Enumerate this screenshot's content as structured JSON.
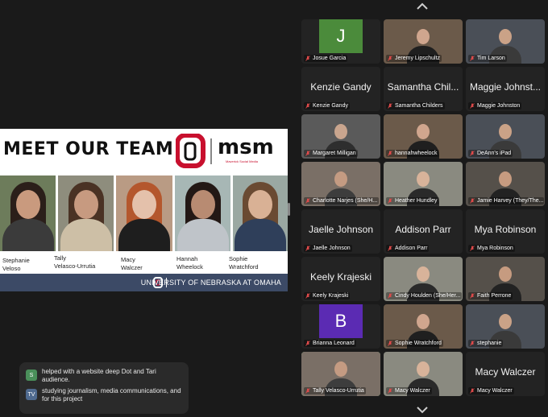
{
  "shared_slide": {
    "title": "MEET OUR TEAM",
    "logo_text": "msm",
    "logo_subtext": "Maverick Social Media",
    "team": [
      {
        "first": "Stephanie",
        "last": "Veloso"
      },
      {
        "first": "Tally",
        "last": "Velasco-Urrutia"
      },
      {
        "first": "Macy",
        "last": "Walczer"
      },
      {
        "first": "Hannah",
        "last": "Wheelock"
      },
      {
        "first": "Sophie",
        "last": "Wratchford"
      }
    ],
    "footer": "UNIVERSITY OF NEBRASKA AT OMAHA",
    "colors": {
      "brand_red": "#c8102e",
      "footer_bg": "#3c4a66"
    }
  },
  "chat": {
    "messages": [
      {
        "avatar": "S",
        "avatar_color": "#4a8f5a",
        "text": "helped with a website deep Dot and Tari audience."
      },
      {
        "avatar": "TV",
        "avatar_color": "#4f6a8f",
        "text": "studying journalism, media communications, and for this project"
      }
    ]
  },
  "gallery": {
    "scroll_up_icon": "chevron-up-icon",
    "scroll_down_icon": "chevron-down-icon",
    "participants": [
      {
        "name": "Josue Garcia",
        "mode": "initial",
        "initial": "J",
        "color": "#4b8b3b"
      },
      {
        "name": "Jeremy Lipschultz",
        "mode": "video"
      },
      {
        "name": "Tim Larson",
        "mode": "video"
      },
      {
        "name": "Kenzie Gandy",
        "mode": "name",
        "display": "Kenzie Gandy"
      },
      {
        "name": "Samantha Childers",
        "mode": "name",
        "display": "Samantha Chil..."
      },
      {
        "name": "Maggie Johnston",
        "mode": "name",
        "display": "Maggie Johnst..."
      },
      {
        "name": "Margaret Milligan",
        "mode": "video"
      },
      {
        "name": "hannahwheelock",
        "mode": "video"
      },
      {
        "name": "DeAnn's iPad",
        "mode": "video"
      },
      {
        "name": "Charlotte Narjes (She/H...",
        "mode": "video"
      },
      {
        "name": "Heather Hundley",
        "mode": "video"
      },
      {
        "name": "Jamie Harvey (They/The...",
        "mode": "video"
      },
      {
        "name": "Jaelle Johnson",
        "mode": "name",
        "display": "Jaelle Johnson"
      },
      {
        "name": "Addison Parr",
        "mode": "name",
        "display": "Addison Parr"
      },
      {
        "name": "Mya Robinson",
        "mode": "name",
        "display": "Mya Robinson"
      },
      {
        "name": "Keely Krajeski",
        "mode": "name",
        "display": "Keely Krajeski"
      },
      {
        "name": "Cindy Houlden (She/Her...",
        "mode": "video"
      },
      {
        "name": "Faith Perrone",
        "mode": "video"
      },
      {
        "name": "Brianna Leonard",
        "mode": "initial",
        "initial": "B",
        "color": "#5b2bb3"
      },
      {
        "name": "Sophie Wratchford",
        "mode": "video"
      },
      {
        "name": "stephanie",
        "mode": "video"
      },
      {
        "name": "Tally Velasco-Urrutia",
        "mode": "video",
        "active": true
      },
      {
        "name": "Macy Walczer",
        "mode": "video"
      },
      {
        "name": "Macy Walczer",
        "mode": "name",
        "display": "Macy Walczer"
      }
    ]
  }
}
